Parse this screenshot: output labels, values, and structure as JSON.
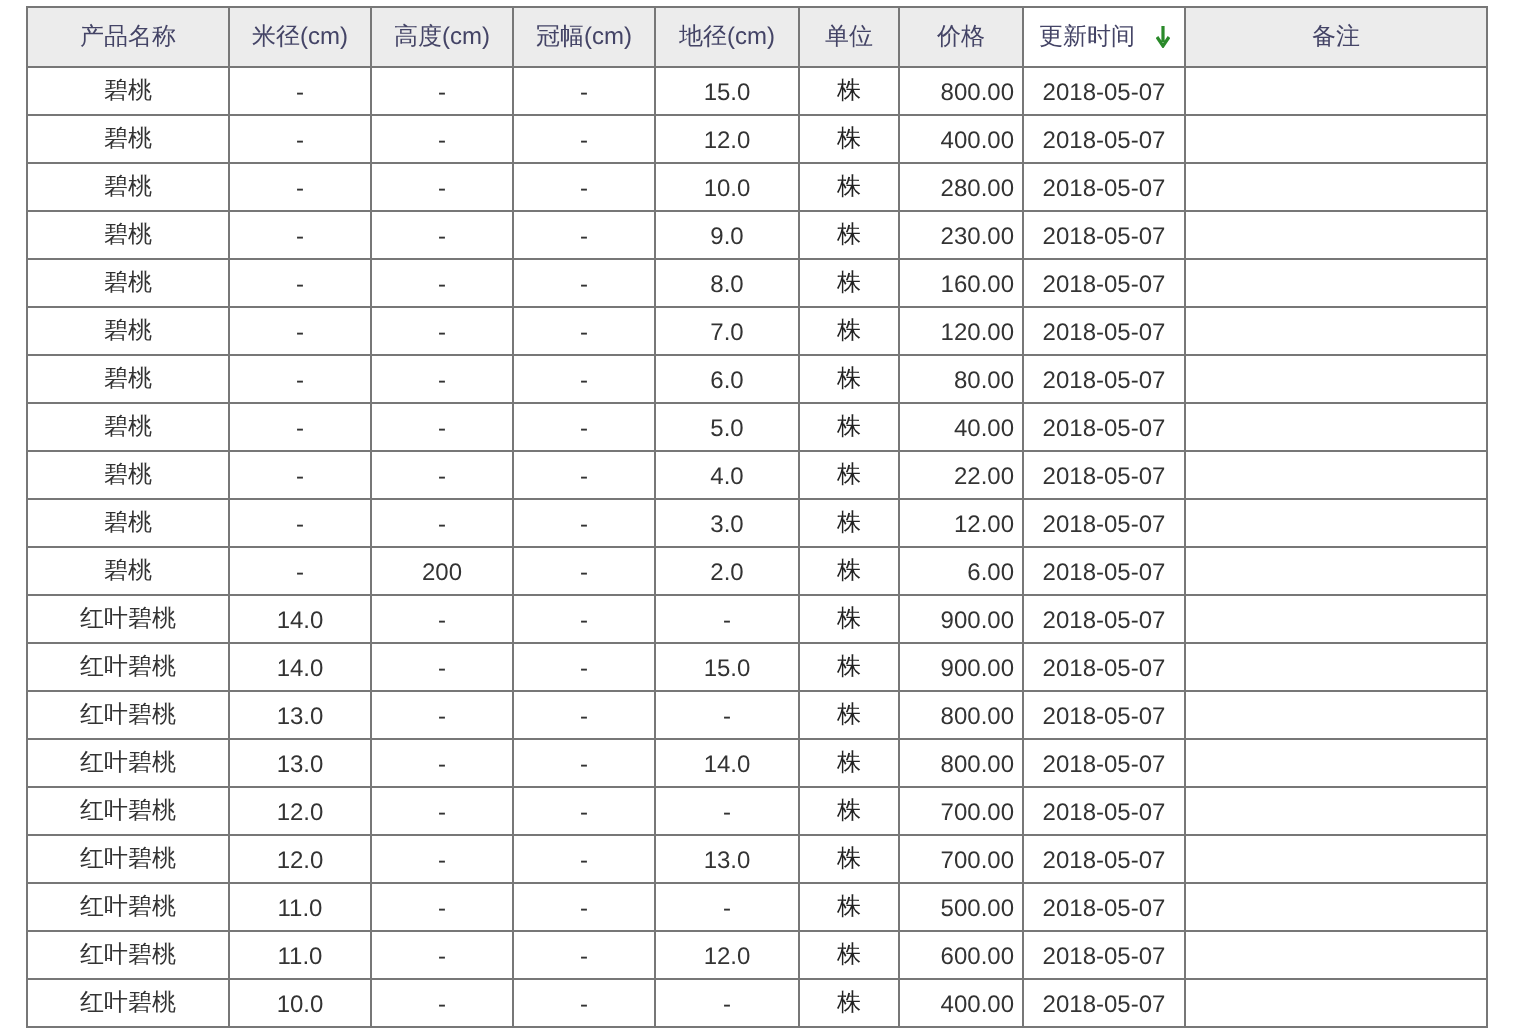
{
  "table": {
    "columns": [
      {
        "label": "产品名称",
        "sorted": false
      },
      {
        "label": "米径(cm)",
        "sorted": false
      },
      {
        "label": "高度(cm)",
        "sorted": false
      },
      {
        "label": "冠幅(cm)",
        "sorted": false
      },
      {
        "label": "地径(cm)",
        "sorted": false
      },
      {
        "label": "单位",
        "sorted": false
      },
      {
        "label": "价格",
        "sorted": false
      },
      {
        "label": "更新时间",
        "sorted": true
      },
      {
        "label": "备注",
        "sorted": false
      }
    ],
    "rows": [
      [
        "碧桃",
        "-",
        "-",
        "-",
        "15.0",
        "株",
        "800.00",
        "2018-05-07"
      ],
      [
        "碧桃",
        "-",
        "-",
        "-",
        "12.0",
        "株",
        "400.00",
        "2018-05-07"
      ],
      [
        "碧桃",
        "-",
        "-",
        "-",
        "10.0",
        "株",
        "280.00",
        "2018-05-07"
      ],
      [
        "碧桃",
        "-",
        "-",
        "-",
        "9.0",
        "株",
        "230.00",
        "2018-05-07"
      ],
      [
        "碧桃",
        "-",
        "-",
        "-",
        "8.0",
        "株",
        "160.00",
        "2018-05-07"
      ],
      [
        "碧桃",
        "-",
        "-",
        "-",
        "7.0",
        "株",
        "120.00",
        "2018-05-07"
      ],
      [
        "碧桃",
        "-",
        "-",
        "-",
        "6.0",
        "株",
        "80.00",
        "2018-05-07"
      ],
      [
        "碧桃",
        "-",
        "-",
        "-",
        "5.0",
        "株",
        "40.00",
        "2018-05-07"
      ],
      [
        "碧桃",
        "-",
        "-",
        "-",
        "4.0",
        "株",
        "22.00",
        "2018-05-07"
      ],
      [
        "碧桃",
        "-",
        "-",
        "-",
        "3.0",
        "株",
        "12.00",
        "2018-05-07"
      ],
      [
        "碧桃",
        "-",
        "200",
        "-",
        "2.0",
        "株",
        "6.00",
        "2018-05-07"
      ],
      [
        "红叶碧桃",
        "14.0",
        "-",
        "-",
        "-",
        "株",
        "900.00",
        "2018-05-07"
      ],
      [
        "红叶碧桃",
        "14.0",
        "-",
        "-",
        "15.0",
        "株",
        "900.00",
        "2018-05-07"
      ],
      [
        "红叶碧桃",
        "13.0",
        "-",
        "-",
        "-",
        "株",
        "800.00",
        "2018-05-07"
      ],
      [
        "红叶碧桃",
        "13.0",
        "-",
        "-",
        "14.0",
        "株",
        "800.00",
        "2018-05-07"
      ],
      [
        "红叶碧桃",
        "12.0",
        "-",
        "-",
        "-",
        "株",
        "700.00",
        "2018-05-07"
      ],
      [
        "红叶碧桃",
        "12.0",
        "-",
        "-",
        "13.0",
        "株",
        "700.00",
        "2018-05-07"
      ],
      [
        "红叶碧桃",
        "11.0",
        "-",
        "-",
        "-",
        "株",
        "500.00",
        "2018-05-07"
      ],
      [
        "红叶碧桃",
        "11.0",
        "-",
        "-",
        "12.0",
        "株",
        "600.00",
        "2018-05-07"
      ],
      [
        "红叶碧桃",
        "10.0",
        "-",
        "-",
        "-",
        "株",
        "400.00",
        "2018-05-07"
      ]
    ]
  }
}
